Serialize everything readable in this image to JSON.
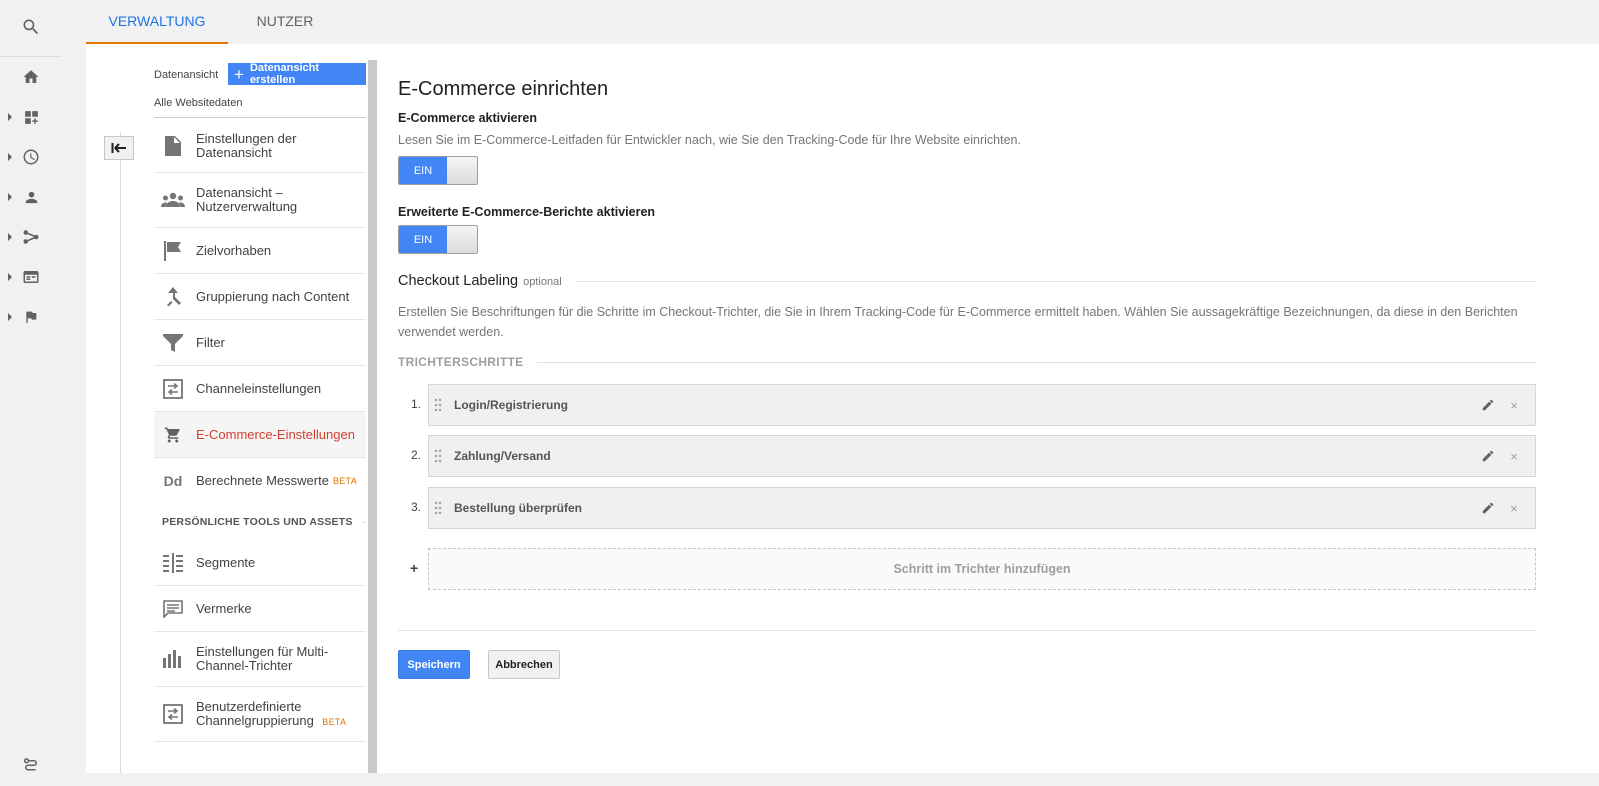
{
  "tabs": [
    {
      "label": "VERWALTUNG",
      "active": true
    },
    {
      "label": "NUTZER",
      "active": false
    }
  ],
  "rail_icons": [
    "search-icon",
    "home-icon",
    "customization-icon",
    "realtime-icon",
    "audience-icon",
    "acquisition-icon",
    "behavior-icon",
    "conversions-icon",
    "attribution-icon"
  ],
  "view_column": {
    "label": "Datenansicht",
    "create_button": "Datenansicht erstellen",
    "selected_view": "Alle Websitedaten"
  },
  "menu": [
    {
      "label": "Einstellungen der Datenansicht",
      "icon": "document-icon"
    },
    {
      "label": "Datenansicht – Nutzerverwaltung",
      "icon": "users-icon"
    },
    {
      "label": "Zielvorhaben",
      "icon": "flag-icon"
    },
    {
      "label": "Gruppierung nach Content",
      "icon": "content-grouping-icon"
    },
    {
      "label": "Filter",
      "icon": "filter-icon"
    },
    {
      "label": "Channeleinstellungen",
      "icon": "channel-settings-icon"
    },
    {
      "label": "E-Commerce-Einstellungen",
      "icon": "cart-icon",
      "selected": true
    },
    {
      "label": "Berechnete Messwerte",
      "icon": "calculated-metrics-icon",
      "badge": "BETA"
    }
  ],
  "personal_section": {
    "title": "PERSÖNLICHE TOOLS UND ASSETS",
    "items": [
      {
        "label": "Segmente",
        "icon": "segments-icon"
      },
      {
        "label": "Vermerke",
        "icon": "annotations-icon"
      },
      {
        "label": "Einstellungen für Multi-Channel-Trichter",
        "icon": "bar-chart-icon"
      },
      {
        "label": "Benutzerdefinierte Channelgruppierung",
        "icon": "custom-channel-icon",
        "badge": "BETA"
      }
    ]
  },
  "content": {
    "title": "E-Commerce einrichten",
    "ecommerce": {
      "heading": "E-Commerce aktivieren",
      "description": "Lesen Sie im E-Commerce-Leitfaden für Entwickler nach, wie Sie den Tracking-Code für Ihre Website einrichten.",
      "toggle_label": "EIN"
    },
    "enhanced": {
      "heading": "Erweiterte E-Commerce-Berichte aktivieren",
      "toggle_label": "EIN"
    },
    "checkout": {
      "title": "Checkout Labeling",
      "optional": "optional",
      "description": "Erstellen Sie Beschriftungen für die Schritte im Checkout-Trichter, die Sie in Ihrem Tracking-Code für E-Commerce ermittelt haben. Wählen Sie aussagekräftige Bezeichnungen, da diese in den Berichten verwendet werden.",
      "funnel_header": "TRICHTERSCHRITTE",
      "steps": [
        {
          "num": "1.",
          "name": "Login/Registrierung"
        },
        {
          "num": "2.",
          "name": "Zahlung/Versand"
        },
        {
          "num": "3.",
          "name": "Bestellung überprüfen"
        }
      ],
      "add_plus": "+",
      "add_step": "Schritt im Trichter hinzufügen",
      "remove_glyph": "×"
    },
    "save_button": "Speichern",
    "cancel_button": "Abbrechen"
  },
  "colors": {
    "accent_blue": "#4285f4",
    "tab_active": "#1a73e8",
    "tab_underline": "#e37400",
    "selected_item": "#d23f31",
    "beta": "#e37400"
  }
}
